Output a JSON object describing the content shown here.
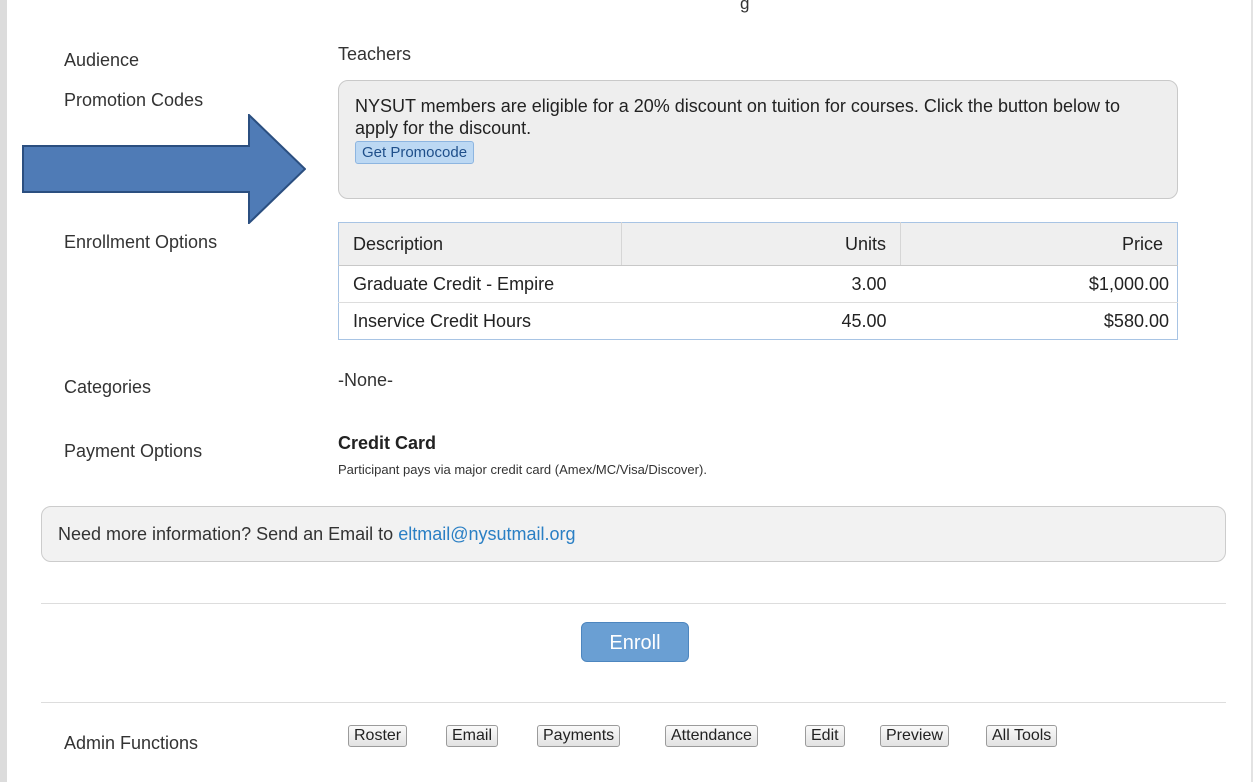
{
  "top_partial_text": "g",
  "labels": {
    "audience": "Audience",
    "promotion_codes": "Promotion Codes",
    "enrollment_options": "Enrollment Options",
    "categories": "Categories",
    "payment_options": "Payment Options",
    "admin_functions": "Admin Functions"
  },
  "audience_value": "Teachers",
  "promo": {
    "message": "NYSUT members are eligible for a 20% discount on tuition for courses. Click the button below to apply for the discount.",
    "button_label": "Get Promocode"
  },
  "enrollment_table": {
    "headers": [
      "Description",
      "Units",
      "Price"
    ],
    "rows": [
      {
        "description": "Graduate Credit - Empire",
        "units": "3.00",
        "price": "$1,000.00"
      },
      {
        "description": "Inservice Credit Hours",
        "units": "45.00",
        "price": "$580.00"
      }
    ]
  },
  "categories_value": "-None-",
  "payment": {
    "title": "Credit Card",
    "description": "Participant pays via major credit card (Amex/MC/Visa/Discover)."
  },
  "info": {
    "text": "Need more information? Send an Email to ",
    "email": "eltmail@nysutmail.org"
  },
  "enroll_button": "Enroll",
  "admin_buttons": [
    "Roster",
    "Email",
    "Payments",
    "Attendance",
    "Edit",
    "Preview",
    "All Tools"
  ],
  "colors": {
    "arrow_fill": "#4f7bb6",
    "arrow_stroke": "#2b4f80",
    "enroll_button": "#6a9fd3",
    "link": "#2a7fc4"
  }
}
